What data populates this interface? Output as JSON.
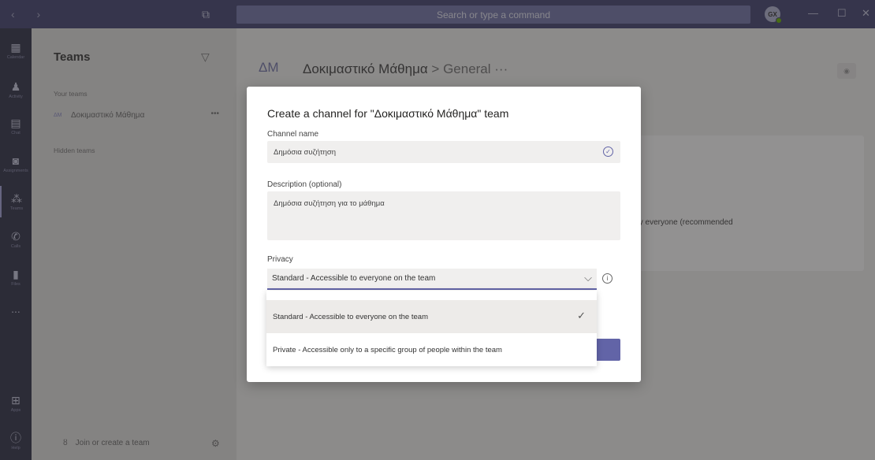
{
  "titlebar": {
    "nav_arrows": "‹ ›",
    "search_placeholder": "Search or type a command",
    "avatar_initials": "GX",
    "minimize": "—",
    "maximize": "☐",
    "close": "✕"
  },
  "rail": {
    "items": [
      {
        "label": "Calendar",
        "icon": "calendar-icon"
      },
      {
        "label": "Activity",
        "icon": "bell-icon"
      },
      {
        "label": "Chat",
        "icon": "chat-icon"
      },
      {
        "label": "Assignments",
        "icon": "backpack-icon"
      },
      {
        "label": "Teams",
        "icon": "teams-icon"
      },
      {
        "label": "Calls",
        "icon": "phone-icon"
      },
      {
        "label": "Files",
        "icon": "file-icon"
      },
      {
        "label": "...",
        "icon": "more-icon"
      },
      {
        "label": "Apps",
        "icon": "apps-icon"
      },
      {
        "label": "Help",
        "icon": "help-icon"
      }
    ]
  },
  "teams_pane": {
    "title": "Teams",
    "your_teams_label": "Your teams",
    "team": {
      "avatar": "ΔΜ",
      "name": "Δοκιμαστικό Μάθημα",
      "more": "•••"
    },
    "hidden_teams_label": "Hidden teams",
    "join_label": "Join or create a team"
  },
  "main": {
    "avatar": "ΔΜ",
    "team_name": "Δοκιμαστικό Μάθημα",
    "separator": " > ",
    "channel": "General",
    "more": " ···",
    "background_text": "fy everyone (recommended"
  },
  "dialog": {
    "title": "Create a channel for \"Δοκιμαστικό Μάθημα\" team",
    "channel_name_label": "Channel name",
    "channel_name_value": "Δημόσια συζήτηση",
    "description_label": "Description (optional)",
    "description_value": "Δημόσια συζήτηση για το μάθημα",
    "privacy_label": "Privacy",
    "privacy_selected": "Standard - Accessible to everyone on the team",
    "privacy_options": [
      {
        "label": "Standard - Accessible to everyone on the team",
        "selected": true
      },
      {
        "label": "Private - Accessible only to a specific group of people within the team",
        "selected": false
      }
    ]
  },
  "colors": {
    "accent": "#6264a7",
    "titlebar": "#464775",
    "rail": "#33344a"
  }
}
